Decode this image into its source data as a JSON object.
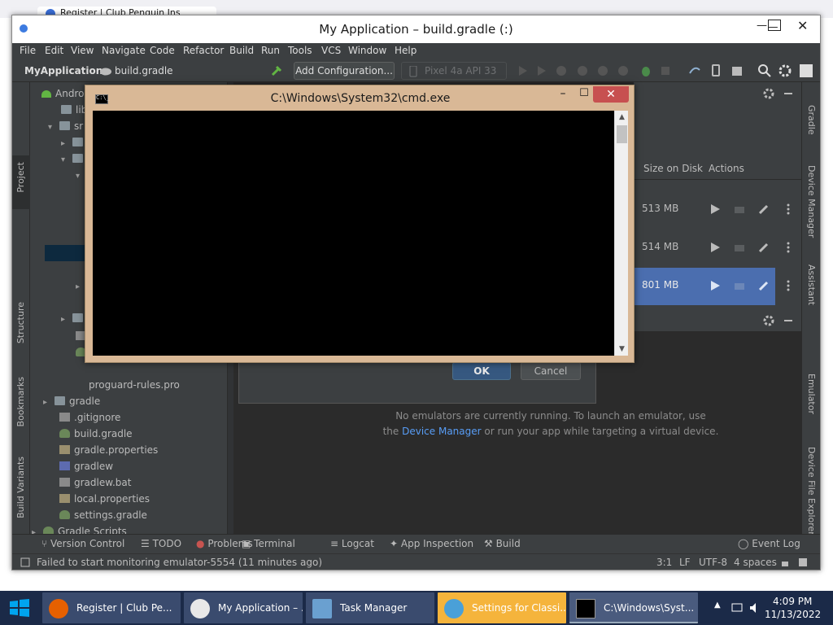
{
  "browser": {
    "tab_title": "Register | Club Penguin Ins"
  },
  "ide": {
    "title": "My Application – build.gradle (:)",
    "menu": [
      "File",
      "Edit",
      "View",
      "Navigate",
      "Code",
      "Refactor",
      "Build",
      "Run",
      "Tools",
      "VCS",
      "Window",
      "Help"
    ],
    "breadcrumb": {
      "project": "MyApplication",
      "file": "build.gradle"
    },
    "toolbar": {
      "add_configuration": "Add Configuration...",
      "device": "Pixel 4a API 33"
    },
    "left_tabs": {
      "project": "Project",
      "structure": "Structure",
      "bookmarks": "Bookmarks",
      "build_variants": "Build Variants"
    },
    "right_tabs": {
      "gradle": "Gradle",
      "device_manager": "Device Manager",
      "assistant": "Assistant",
      "emulator": "Emulator",
      "device_file_explorer": "Device File Explorer"
    },
    "project_tree": {
      "root": "Andro",
      "libs": "lib",
      "src": "sr",
      "gitfile": ".g",
      "buildfile": "bu",
      "proguard": "proguard-rules.pro",
      "items": [
        "gradle",
        ".gitignore",
        "build.gradle",
        "gradle.properties",
        "gradlew",
        "gradlew.bat",
        "local.properties",
        "settings.gradle"
      ],
      "gradle_scripts": "Gradle Scripts"
    },
    "device_manager": {
      "columns": {
        "size": "Size on Disk",
        "actions": "Actions"
      },
      "rows": [
        {
          "size": "513 MB",
          "selected": false
        },
        {
          "size": "514 MB",
          "selected": false
        },
        {
          "size": "801 MB",
          "selected": true
        }
      ]
    },
    "emulator": {
      "ok": "OK",
      "cancel": "Cancel",
      "message_line1": "No emulators are currently running. To launch an emulator, use",
      "message_pre": "the",
      "message_link": "Device Manager",
      "message_post": "or run your app while targeting a virtual device."
    },
    "bottom_tools": [
      "Version Control",
      "TODO",
      "Problems",
      "Terminal",
      "Logcat",
      "App Inspection",
      "Build"
    ],
    "event_log": "Event Log",
    "status": {
      "message": "Failed to start monitoring emulator-5554 (11 minutes ago)",
      "position": "3:1",
      "line_sep": "LF",
      "encoding": "UTF-8",
      "indent": "4 spaces"
    }
  },
  "cmd": {
    "title": "C:\\Windows\\System32\\cmd.exe",
    "icon_text": "C:\\_"
  },
  "taskbar": {
    "tasks": [
      "Register | Club Pe...",
      "My Application – ...",
      "Task Manager",
      "Settings for Classi...",
      "C:\\Windows\\Syst..."
    ],
    "time": "4:09 PM",
    "date": "11/13/2022"
  },
  "colors": {
    "ide_bg": "#2b2b2b",
    "panel": "#3c3f41",
    "selection": "#4b6eaf",
    "link": "#589df6",
    "cmd_frame": "#d9b896",
    "cmd_close": "#c75050",
    "taskbar": "#1b2a48"
  }
}
